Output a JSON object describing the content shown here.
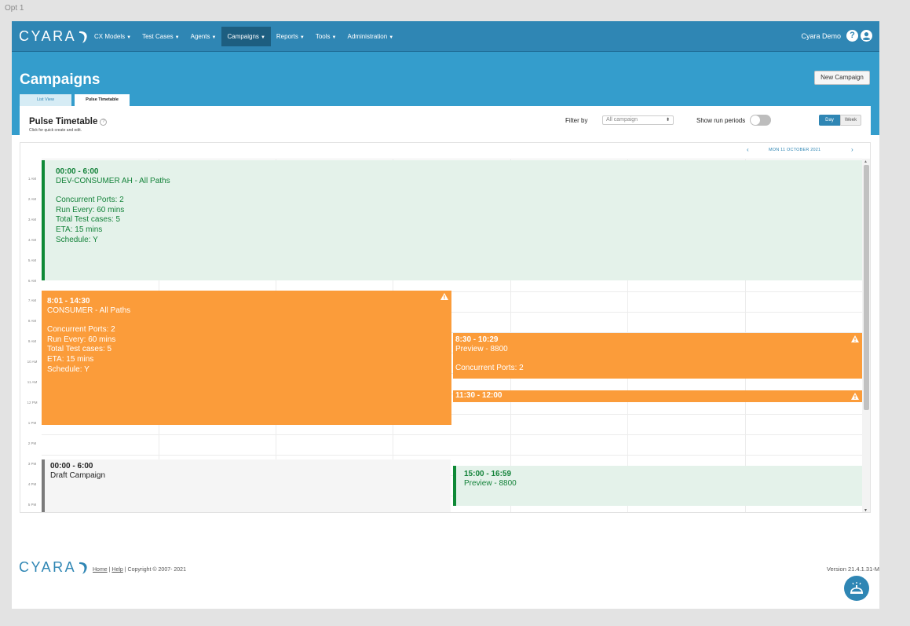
{
  "option_label": "Opt 1",
  "brand": {
    "name": "CYARA",
    "color": "#2f86b4"
  },
  "nav": {
    "items": [
      {
        "label": "CX Models",
        "active": false
      },
      {
        "label": "Test Cases",
        "active": false
      },
      {
        "label": "Agents",
        "active": false
      },
      {
        "label": "Campaigns",
        "active": true
      },
      {
        "label": "Reports",
        "active": false
      },
      {
        "label": "Tools",
        "active": false
      },
      {
        "label": "Administration",
        "active": false
      }
    ],
    "user_name": "Cyara Demo",
    "help_icon": "question-circle-icon",
    "user_icon": "user-circle-icon"
  },
  "header": {
    "title": "Campaigns",
    "new_campaign_label": "New Campaign",
    "tabs": [
      {
        "label": "List View",
        "active": false
      },
      {
        "label": "Pulse Timetable",
        "active": true
      }
    ]
  },
  "timetable": {
    "title": "Pulse Timetable",
    "help_label": "?",
    "subtitle": "Click for quick create and edit.",
    "filter_label": "Filter by",
    "filter_value": "All campaign",
    "show_run_periods_label": "Show run periods",
    "show_run_periods_on": false,
    "view_day_label": "Day",
    "view_week_label": "Week",
    "selected_view": "Day",
    "date_label": "MON 11 OCTOBER 2021",
    "hours": [
      "1 AM",
      "2 AM",
      "3 AM",
      "4 AM",
      "5 AM",
      "6 AM",
      "7 AM",
      "8 AM",
      "9 AM",
      "10 AM",
      "11 AM",
      "12 PM",
      "1 PM",
      "2 PM",
      "3 PM",
      "4 PM",
      "5 PM"
    ]
  },
  "events": {
    "dev_consumer": {
      "time": "00:00 - 6:00",
      "name": "DEV-CONSUMER AH - All Paths",
      "details": [
        "Concurrent Ports: 2",
        "Run Every: 60 mins",
        "Total Test cases: 5",
        "ETA: 15 mins",
        "Schedule: Y"
      ],
      "status": "green"
    },
    "consumer": {
      "time": "8:01 - 14:30",
      "name": "CONSUMER - All Paths",
      "details": [
        "Concurrent Ports: 2",
        "Run Every: 60 mins",
        "Total Test cases: 5",
        "ETA: 15 mins",
        "Schedule: Y"
      ],
      "status": "warning"
    },
    "preview_1": {
      "time": "8:30 - 10:29",
      "name": "Preview - 8800",
      "details": [
        "Concurrent Ports: 2"
      ],
      "status": "warning"
    },
    "short_run": {
      "time": "11:30 - 12:00",
      "status": "warning"
    },
    "draft": {
      "time": "00:00 - 6:00",
      "name": "Draft Campaign",
      "status": "draft"
    },
    "preview_2": {
      "time": "15:00 - 16:59",
      "name": "Preview - 8800",
      "status": "green"
    }
  },
  "colors": {
    "success": "#0f8a37",
    "warning": "#fb9c3a",
    "draft": "#7a7a7a"
  },
  "footer": {
    "home_label": "Home",
    "help_label": "Help",
    "copyright": "Copyright © 2007- 2021",
    "version": "Version 21.4.1.31-M",
    "bell_icon": "service-bell-icon"
  }
}
